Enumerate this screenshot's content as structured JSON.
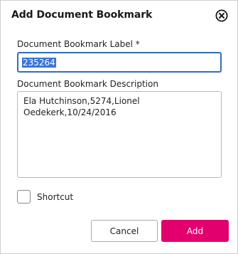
{
  "dialog": {
    "title": "Add Document Bookmark",
    "close_icon": "close-circle-icon"
  },
  "label_field": {
    "label": "Document Bookmark Label  *",
    "value": "235264",
    "value_selected": true
  },
  "description_field": {
    "label": "Document Bookmark Description",
    "value": "Ela Hutchinson,5274,Lionel\nOedekerk,10/24/2016"
  },
  "shortcut": {
    "label": "Shortcut",
    "checked": false
  },
  "buttons": {
    "cancel_label": "Cancel",
    "add_label": "Add"
  },
  "colors": {
    "accent": "#e2006f",
    "focus_border": "#2f6fb6",
    "selection": "#3b74d6"
  }
}
